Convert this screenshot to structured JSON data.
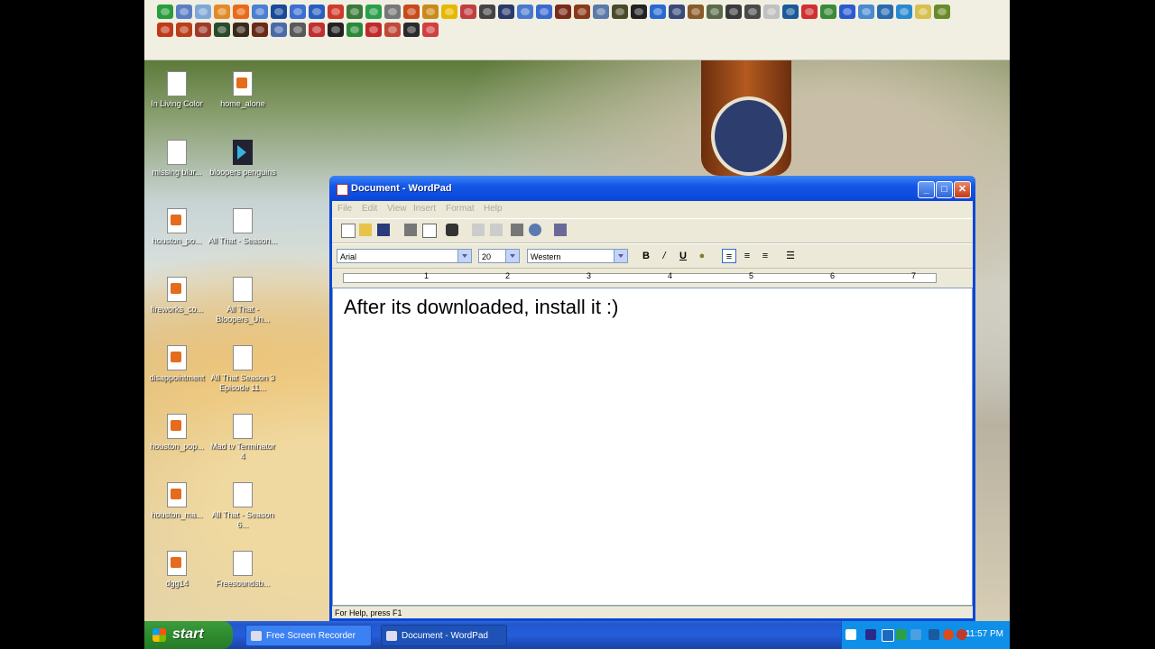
{
  "quick_launch": {
    "row1_colors": [
      "#2a9d3c",
      "#5b7fc2",
      "#7fa7d8",
      "#e28a2a",
      "#e86a1a",
      "#4a7fd1",
      "#1a4a9a",
      "#3c6fcf",
      "#2b5fbf",
      "#d03a2a",
      "#3a7a3a",
      "#2aa04a",
      "#777",
      "#c84a1a",
      "#c98a1a",
      "#e6b800",
      "#c04040",
      "#444",
      "#2a3a6a",
      "#4a7acf",
      "#3a6ad0",
      "#7a2a1a",
      "#8a3a1a",
      "#5a7aaa",
      "#4a4a2a",
      "#222",
      "#2a6acf",
      "#3a4a7a",
      "#8a5a2a",
      "#5a6a4a",
      "#3a3a3a",
      "#4a4a4a",
      "#c0c0c0",
      "#1a5a9a",
      "#d03030",
      "#3a8a3a",
      "#2a5acf",
      "#4a8acf",
      "#2a6aaf",
      "#2a8acf",
      "#d6c050",
      "#6a8a2a"
    ],
    "row2_colors": [
      "#c03a1a",
      "#b8401a",
      "#a03a2a",
      "#2a4a2a",
      "#3a2a1a",
      "#6a2a1a",
      "#4a6aaa",
      "#5a5a5a",
      "#c03030",
      "#222",
      "#2a8a3a",
      "#c02a2a",
      "#c04a3a",
      "#2a2a2a",
      "#d04040"
    ]
  },
  "desktop_icons": [
    {
      "label": "In Living Color",
      "type": "doc"
    },
    {
      "label": "home_alone",
      "type": "vid"
    },
    {
      "label": "missing blur...",
      "type": "doc"
    },
    {
      "label": "bloopers penguins",
      "type": "dark"
    },
    {
      "label": "houston_po...",
      "type": "vid"
    },
    {
      "label": "All That - Season...",
      "type": "doc"
    },
    {
      "label": "fireworks_co...",
      "type": "vid"
    },
    {
      "label": "All That - Bloopers_Un...",
      "type": "doc"
    },
    {
      "label": "disappointment",
      "type": "vid"
    },
    {
      "label": "All That Season 3 Episode 11...",
      "type": "doc"
    },
    {
      "label": "houston_pop...",
      "type": "vid"
    },
    {
      "label": "Mad tv Terminator 4",
      "type": "doc"
    },
    {
      "label": "houston_ma...",
      "type": "vid"
    },
    {
      "label": "All That - Season 6...",
      "type": "doc"
    },
    {
      "label": "dgg14",
      "type": "vid"
    },
    {
      "label": "Freesoundsb...",
      "type": "doc"
    }
  ],
  "wordpad": {
    "title": "Document - WordPad",
    "menu": [
      "File",
      "Edit",
      "View",
      "Insert",
      "Format",
      "Help"
    ],
    "font_name": "Arial",
    "font_size": "20",
    "script": "Western",
    "format_buttons": {
      "bold": "B",
      "italic": "/",
      "underline": "U"
    },
    "ruler_numbers": [
      "1",
      "2",
      "3",
      "4",
      "5",
      "6",
      "7"
    ],
    "document_text": "After its downloaded, install it :)",
    "status": "For Help, press F1"
  },
  "taskbar": {
    "start_label": "start",
    "tasks": [
      {
        "label": "Free Screen Recorder",
        "active": false
      },
      {
        "label": "Document - WordPad",
        "active": true
      }
    ],
    "clock": "11:57 PM"
  }
}
